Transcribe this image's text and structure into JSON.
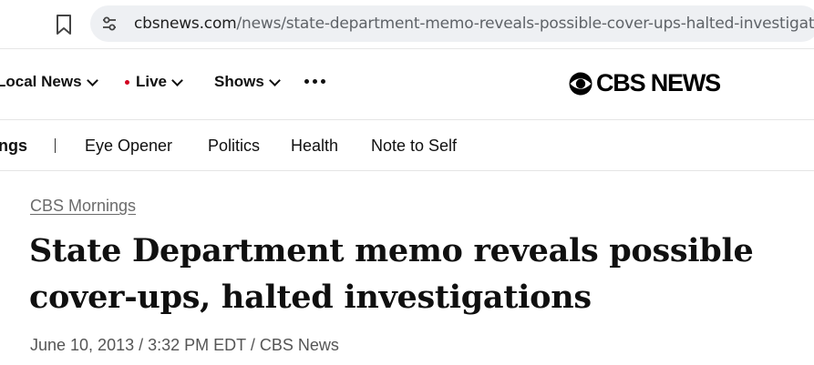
{
  "browser": {
    "url_domain": "cbsnews.com",
    "url_path": "/news/state-department-memo-reveals-possible-cover-ups-halted-investigations/",
    "icons": [
      "bookmark-icon",
      "site-settings-icon"
    ]
  },
  "nav": {
    "local_news": "Local News",
    "live": "Live",
    "shows": "Shows",
    "more_icon": "more-icon",
    "logo_text": "CBS NEWS",
    "live_dot_color": "#d1001f"
  },
  "subnav": {
    "current": "ngs",
    "separator": "|",
    "items": [
      "Eye Opener",
      "Politics",
      "Health",
      "Note to Self"
    ]
  },
  "article": {
    "eyebrow": "CBS Mornings",
    "headline": "State Department memo reveals possible cover-ups, halted investigations",
    "byline": "June 10, 2013 / 3:32 PM EDT / CBS News"
  }
}
